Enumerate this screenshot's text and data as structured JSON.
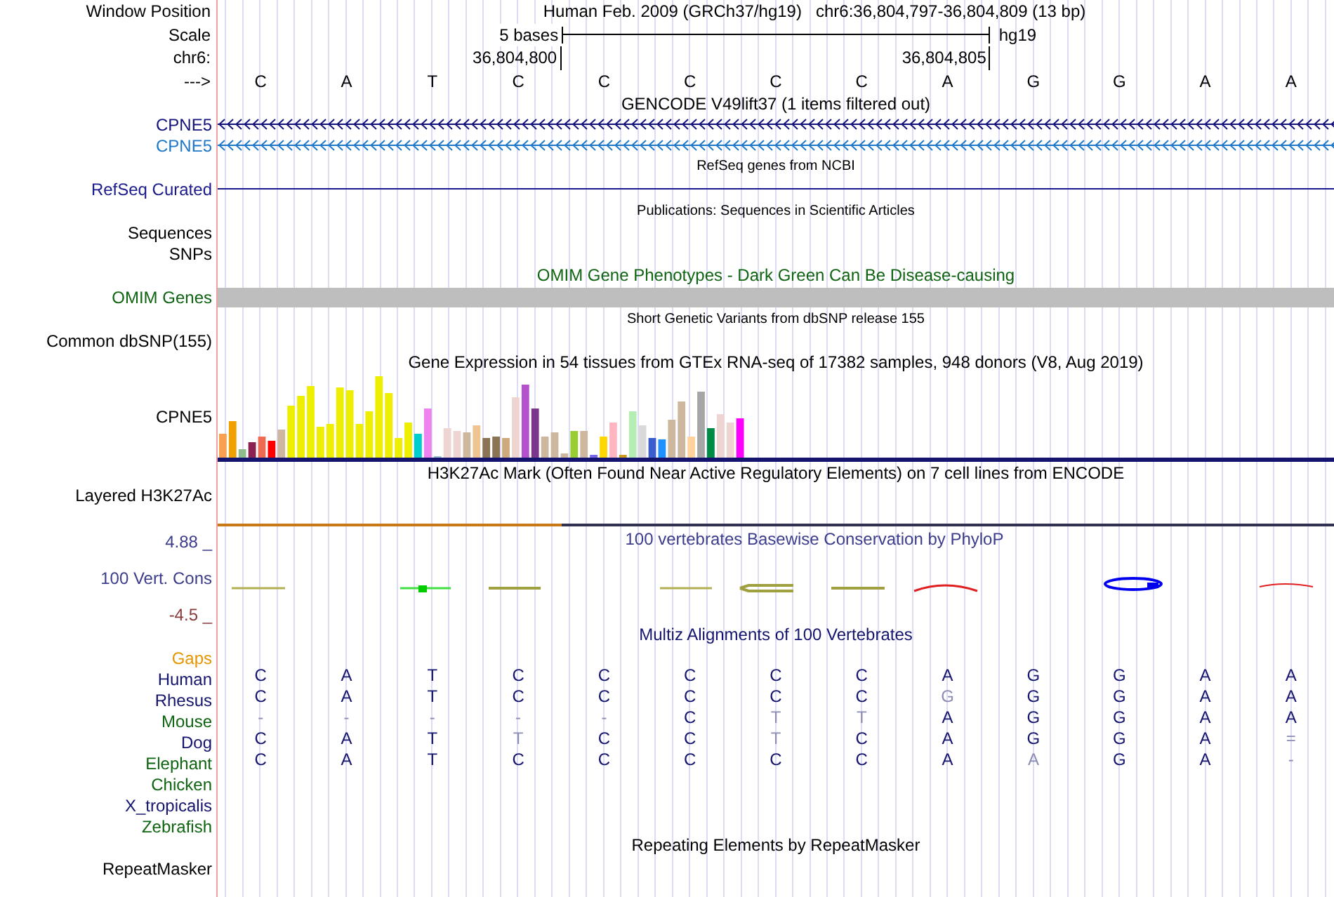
{
  "header": {
    "labels": [
      "Window Position",
      "Scale",
      "chr6:",
      "--->"
    ],
    "assembly": "Human Feb. 2009 (GRCh37/hg19)",
    "position": "chr6:36,804,797-36,804,809 (13 bp)",
    "scale_label": "5 bases",
    "scale_db": "hg19",
    "coord_start": "36,804,800",
    "coord_end": "36,804,805",
    "bases": [
      "C",
      "A",
      "T",
      "C",
      "C",
      "C",
      "C",
      "C",
      "A",
      "G",
      "G",
      "A",
      "A"
    ]
  },
  "rows": [
    {
      "kind": "title",
      "text": "GENCODE V49lift37 (1 items filtered out)",
      "small": false,
      "color": "#000000"
    },
    {
      "kind": "gene",
      "label": "CPNE5",
      "color": "#12127a"
    },
    {
      "kind": "gene",
      "label": "CPNE5",
      "color": "#1e78c8"
    },
    {
      "kind": "title",
      "text": "RefSeq genes from NCBI",
      "small": true,
      "color": "#000000"
    },
    {
      "kind": "line",
      "label": "RefSeq Curated",
      "color": "#1a1a8c"
    },
    {
      "kind": "title",
      "text": "Publications: Sequences in Scientific Articles",
      "small": true,
      "color": "#000000"
    },
    {
      "kind": "label",
      "label": "Sequences",
      "color": "#000000"
    },
    {
      "kind": "label",
      "label": "SNPs",
      "color": "#000000"
    },
    {
      "kind": "title",
      "text": "OMIM Gene Phenotypes - Dark Green Can Be Disease-causing",
      "small": false,
      "color": "#0e6410"
    },
    {
      "kind": "bar",
      "label": "OMIM Genes",
      "color": "#0e6410"
    },
    {
      "kind": "title",
      "text": "Short Genetic Variants from dbSNP release 155",
      "small": true,
      "color": "#000000"
    },
    {
      "kind": "label",
      "label": "Common dbSNP(155)",
      "color": "#000000"
    },
    {
      "kind": "title",
      "text": "Gene Expression in 54 tissues from GTEx RNA-seq of 17382 samples, 948 donors (V8, Aug 2019)",
      "small": false,
      "color": "#000000"
    },
    {
      "kind": "expression",
      "label": "CPNE5",
      "color": "#000000"
    },
    {
      "kind": "title",
      "text": "H3K27Ac Mark (Often Found Near Active Regulatory Elements) on 7 cell lines from ENCODE",
      "small": false,
      "color": "#000000"
    },
    {
      "kind": "layered",
      "label": "Layered H3K27Ac",
      "color": "#000000"
    },
    {
      "kind": "conservation",
      "label": "100 Vert. Cons",
      "color": "#3c3c8c",
      "title": "100 vertebrates Basewise Conservation by PhyloP",
      "max_label": "4.88 _",
      "min_label": "-4.5 _"
    },
    {
      "kind": "title",
      "text": "Multiz Alignments of 100 Vertebrates",
      "small": false,
      "color": "#14146e"
    },
    {
      "kind": "label",
      "label": "Gaps",
      "color": "#e69500"
    },
    {
      "kind": "species",
      "label": "Human",
      "color": "#14146e",
      "bases": [
        {
          "letter": "C",
          "conserved": true
        },
        {
          "letter": "A",
          "conserved": true
        },
        {
          "letter": "T",
          "conserved": true
        },
        {
          "letter": "C",
          "conserved": true
        },
        {
          "letter": "C",
          "conserved": true
        },
        {
          "letter": "C",
          "conserved": true
        },
        {
          "letter": "C",
          "conserved": true
        },
        {
          "letter": "C",
          "conserved": true
        },
        {
          "letter": "A",
          "conserved": true
        },
        {
          "letter": "G",
          "conserved": true
        },
        {
          "letter": "G",
          "conserved": true
        },
        {
          "letter": "A",
          "conserved": true
        },
        {
          "letter": "A",
          "conserved": true
        }
      ]
    },
    {
      "kind": "species",
      "label": "Rhesus",
      "color": "#14146e",
      "bases": [
        {
          "letter": "C",
          "conserved": true
        },
        {
          "letter": "A",
          "conserved": true
        },
        {
          "letter": "T",
          "conserved": true
        },
        {
          "letter": "C",
          "conserved": true
        },
        {
          "letter": "C",
          "conserved": true
        },
        {
          "letter": "C",
          "conserved": true
        },
        {
          "letter": "C",
          "conserved": true
        },
        {
          "letter": "C",
          "conserved": true
        },
        {
          "letter": "G",
          "conserved": false
        },
        {
          "letter": "G",
          "conserved": true
        },
        {
          "letter": "G",
          "conserved": true
        },
        {
          "letter": "A",
          "conserved": true
        },
        {
          "letter": "A",
          "conserved": true
        }
      ]
    },
    {
      "kind": "species",
      "label": "Mouse",
      "color": "#0e6410",
      "bases": [
        {
          "letter": "-",
          "conserved": false
        },
        {
          "letter": "-",
          "conserved": false
        },
        {
          "letter": "-",
          "conserved": false
        },
        {
          "letter": "-",
          "conserved": false
        },
        {
          "letter": "-",
          "conserved": false
        },
        {
          "letter": "C",
          "conserved": true
        },
        {
          "letter": "T",
          "conserved": false
        },
        {
          "letter": "T",
          "conserved": false
        },
        {
          "letter": "A",
          "conserved": true
        },
        {
          "letter": "G",
          "conserved": true
        },
        {
          "letter": "G",
          "conserved": true
        },
        {
          "letter": "A",
          "conserved": true
        },
        {
          "letter": "A",
          "conserved": true
        }
      ]
    },
    {
      "kind": "species",
      "label": "Dog",
      "color": "#14146e",
      "bases": [
        {
          "letter": "C",
          "conserved": true
        },
        {
          "letter": "A",
          "conserved": true
        },
        {
          "letter": "T",
          "conserved": true
        },
        {
          "letter": "T",
          "conserved": false
        },
        {
          "letter": "C",
          "conserved": true
        },
        {
          "letter": "C",
          "conserved": true
        },
        {
          "letter": "T",
          "conserved": false
        },
        {
          "letter": "C",
          "conserved": true
        },
        {
          "letter": "A",
          "conserved": true
        },
        {
          "letter": "G",
          "conserved": true
        },
        {
          "letter": "G",
          "conserved": true
        },
        {
          "letter": "A",
          "conserved": true
        },
        {
          "letter": "=",
          "conserved": false
        }
      ]
    },
    {
      "kind": "species",
      "label": "Elephant",
      "color": "#0e6410",
      "bases": [
        {
          "letter": "C",
          "conserved": true
        },
        {
          "letter": "A",
          "conserved": true
        },
        {
          "letter": "T",
          "conserved": true
        },
        {
          "letter": "C",
          "conserved": true
        },
        {
          "letter": "C",
          "conserved": true
        },
        {
          "letter": "C",
          "conserved": true
        },
        {
          "letter": "C",
          "conserved": true
        },
        {
          "letter": "C",
          "conserved": true
        },
        {
          "letter": "A",
          "conserved": true
        },
        {
          "letter": "A",
          "conserved": false
        },
        {
          "letter": "G",
          "conserved": true
        },
        {
          "letter": "A",
          "conserved": true
        },
        {
          "letter": "-",
          "conserved": false
        }
      ]
    },
    {
      "kind": "label",
      "label": "Chicken",
      "color": "#0e6410"
    },
    {
      "kind": "label",
      "label": "X_tropicalis",
      "color": "#14146e"
    },
    {
      "kind": "label",
      "label": "Zebrafish",
      "color": "#0e6410"
    },
    {
      "kind": "title",
      "text": "Repeating Elements by RepeatMasker",
      "small": false,
      "color": "#000000"
    },
    {
      "kind": "label",
      "label": "RepeatMasker",
      "color": "#000000"
    }
  ]
}
